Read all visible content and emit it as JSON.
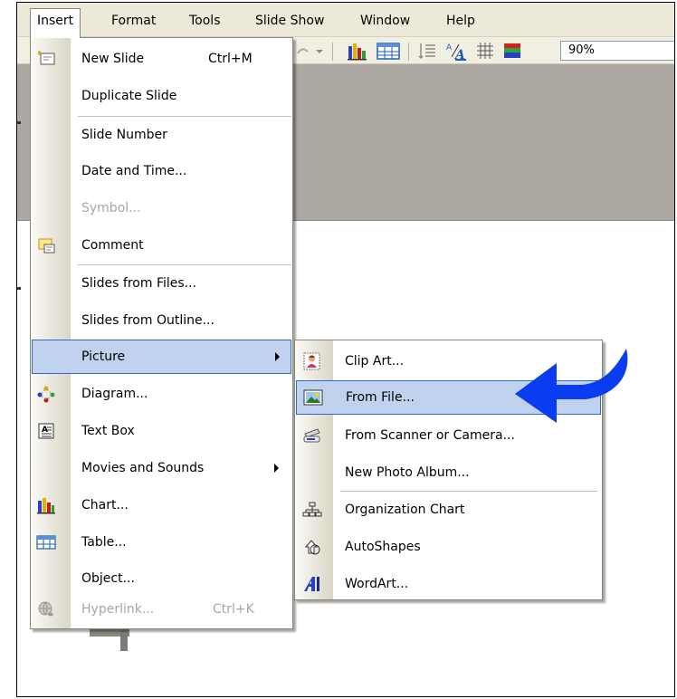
{
  "menubar": {
    "items": [
      "Insert",
      "Format",
      "Tools",
      "Slide Show",
      "Window",
      "Help"
    ]
  },
  "toolbar": {
    "zoom": "90%"
  },
  "insert_menu": {
    "items": [
      {
        "label": "New Slide",
        "shortcut": "Ctrl+M",
        "icon": "new-slide-icon"
      },
      {
        "label": "Duplicate Slide"
      },
      {
        "label": "Slide Number"
      },
      {
        "label": "Date and Time..."
      },
      {
        "label": "Symbol...",
        "disabled": true
      },
      {
        "label": "Comment",
        "icon": "comment-icon"
      },
      {
        "label": "Slides from Files..."
      },
      {
        "label": "Slides from Outline..."
      },
      {
        "label": "Picture",
        "submenu": true,
        "highlighted": true
      },
      {
        "label": "Diagram...",
        "icon": "diagram-icon"
      },
      {
        "label": "Text Box",
        "icon": "text-box-icon"
      },
      {
        "label": "Movies and Sounds",
        "submenu": true
      },
      {
        "label": "Chart...",
        "icon": "chart-icon"
      },
      {
        "label": "Table...",
        "icon": "table-icon"
      },
      {
        "label": "Object..."
      },
      {
        "label": "Hyperlink...",
        "shortcut": "Ctrl+K",
        "disabled": true,
        "icon": "hyperlink-icon"
      }
    ]
  },
  "picture_submenu": {
    "items": [
      {
        "label": "Clip Art...",
        "icon": "clip-art-icon"
      },
      {
        "label": "From File...",
        "icon": "from-file-icon",
        "highlighted": true
      },
      {
        "label": "From Scanner or Camera...",
        "icon": "scanner-icon"
      },
      {
        "label": "New Photo Album..."
      },
      {
        "label": "Organization Chart",
        "icon": "org-chart-icon"
      },
      {
        "label": "AutoShapes",
        "icon": "autoshapes-icon"
      },
      {
        "label": "WordArt...",
        "icon": "wordart-icon"
      }
    ]
  },
  "colors": {
    "highlight": "#c1d2ee",
    "highlight_border": "#316ac5",
    "pointer_arrow": "#0a3cf0"
  }
}
